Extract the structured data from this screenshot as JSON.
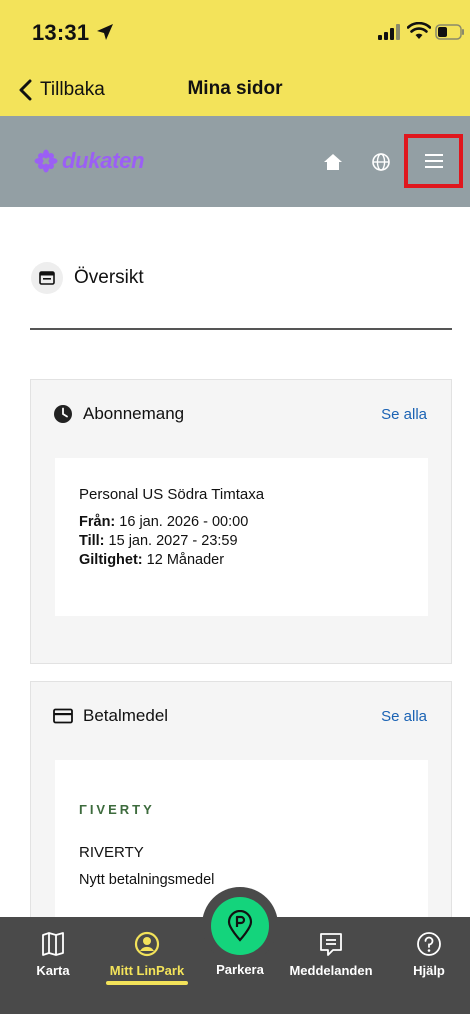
{
  "status_bar": {
    "time": "13:31"
  },
  "nav": {
    "back_label": "Tillbaka",
    "title": "Mina sidor"
  },
  "app_header": {
    "logo_text": "dukaten"
  },
  "overview": {
    "title": "Översikt"
  },
  "subscriptions": {
    "title": "Abonnemang",
    "see_all": "Se alla",
    "item": {
      "name": "Personal US Södra Timtaxa",
      "from_label": "Från:",
      "from_value": "16 jan. 2026 - 00:00",
      "to_label": "Till:",
      "to_value": "15 jan. 2027 - 23:59",
      "validity_label": "Giltighet:",
      "validity_value": "12 Månader"
    }
  },
  "payment": {
    "title": "Betalmedel",
    "see_all": "Se alla",
    "logo_text": "ΓIVERTY",
    "method_name": "RIVERTY",
    "method_desc": "Nytt betalningsmedel"
  },
  "tabbar": {
    "items": [
      {
        "label": "Karta",
        "icon": "map-icon"
      },
      {
        "label": "Mitt LinPark",
        "icon": "user-circle-icon",
        "active": true
      },
      {
        "label": "Parkera",
        "icon": "parking-pin-icon"
      },
      {
        "label": "Meddelanden",
        "icon": "message-icon"
      },
      {
        "label": "Hjälp",
        "icon": "help-icon"
      }
    ]
  },
  "colors": {
    "status_bar_bg": "#f3e35a",
    "header_bg": "#939fa4",
    "brand_purple": "#9b5ff5",
    "link_blue": "#1b63b4",
    "highlight_red": "#e0161d",
    "park_green": "#14d47c",
    "tabbar_bg": "#4a4a4a",
    "active_tab": "#f3e35a"
  }
}
